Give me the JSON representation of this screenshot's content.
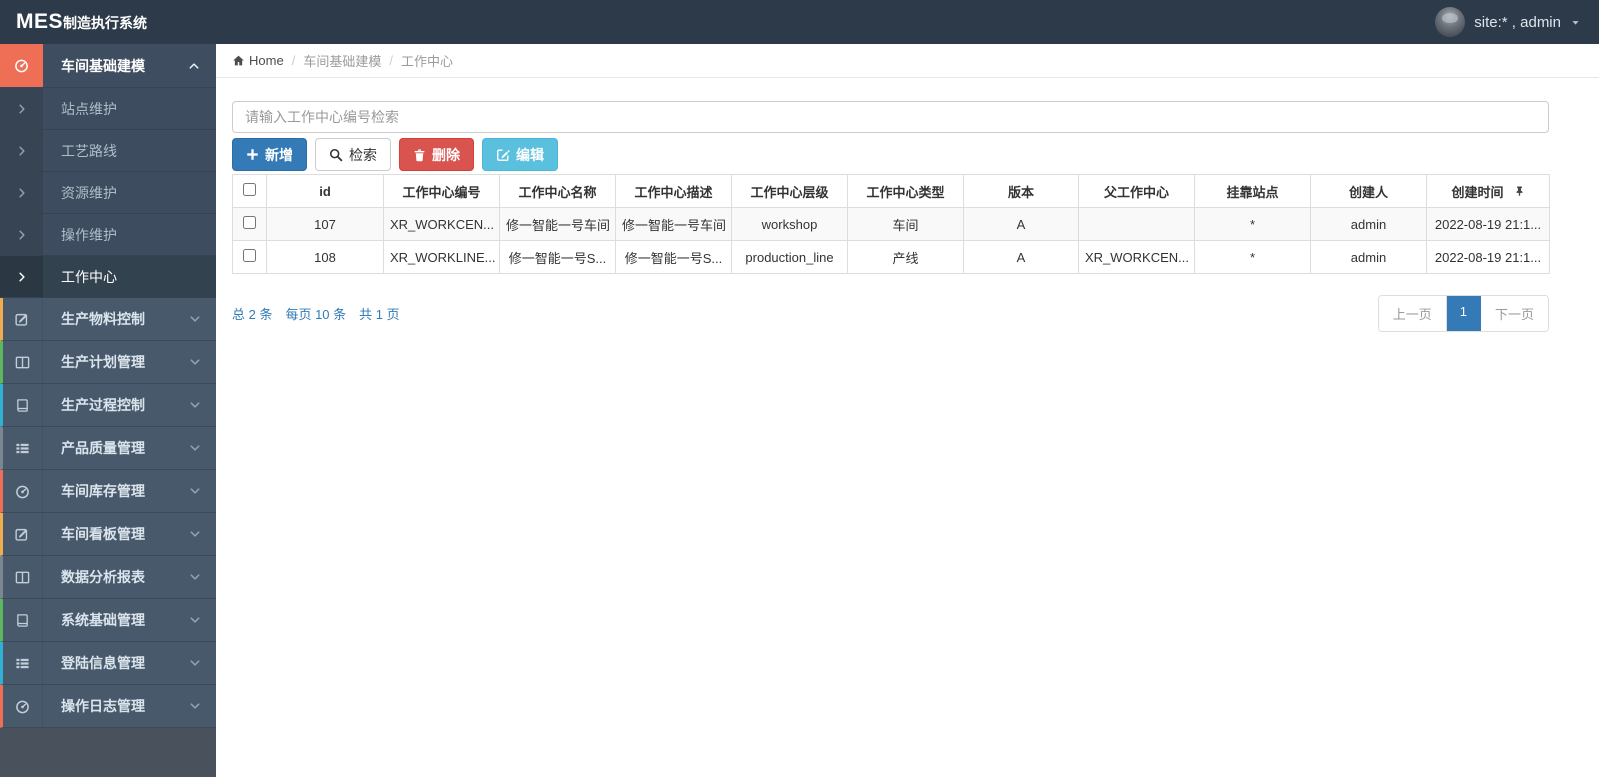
{
  "colors": {
    "topbar": "#2d3a4a",
    "sidebar_accent": "#ee6e56",
    "primary": "#337ab7",
    "danger": "#d9534f",
    "info": "#5bc0de"
  },
  "topbar": {
    "brand_bold": "MES",
    "brand_rest": "制造执行系统",
    "user_label": "site:* , admin"
  },
  "sidebar": {
    "group": {
      "label": "车间基础建模",
      "icon": "gauge"
    },
    "submenu": [
      {
        "label": "站点维护"
      },
      {
        "label": "工艺路线"
      },
      {
        "label": "资源维护"
      },
      {
        "label": "操作维护"
      },
      {
        "label": "工作中心"
      }
    ],
    "items": [
      {
        "label": "生产物料控制",
        "icon": "pencil",
        "stripe": "#f0ad4e"
      },
      {
        "label": "生产计划管理",
        "icon": "columns",
        "stripe": "#5cb85c"
      },
      {
        "label": "生产过程控制",
        "icon": "book",
        "stripe": "#31b0d5"
      },
      {
        "label": "产品质量管理",
        "icon": "list",
        "stripe": "#7a8793"
      },
      {
        "label": "车间库存管理",
        "icon": "gauge",
        "stripe": "#ee6e56"
      },
      {
        "label": "车间看板管理",
        "icon": "pencil",
        "stripe": "#f0ad4e"
      },
      {
        "label": "数据分析报表",
        "icon": "columns",
        "stripe": "#7a8793"
      },
      {
        "label": "系统基础管理",
        "icon": "book",
        "stripe": "#5cb85c"
      },
      {
        "label": "登陆信息管理",
        "icon": "list",
        "stripe": "#31b0d5"
      },
      {
        "label": "操作日志管理",
        "icon": "gauge",
        "stripe": "#ee6e56"
      }
    ]
  },
  "breadcrumb": {
    "home": "Home",
    "separator": "/",
    "items": [
      "车间基础建模",
      "工作中心"
    ]
  },
  "toolbar": {
    "search_placeholder": "请输入工作中心编号检索",
    "buttons": [
      {
        "label": "新增",
        "icon": "plus"
      },
      {
        "label": "检索",
        "icon": "search"
      },
      {
        "label": "删除",
        "icon": "trash"
      },
      {
        "label": "编辑",
        "icon": "edit"
      }
    ]
  },
  "table": {
    "columns": [
      "id",
      "工作中心编号",
      "工作中心名称",
      "工作中心描述",
      "工作中心层级",
      "工作中心类型",
      "版本",
      "父工作中心",
      "挂靠站点",
      "创建人",
      "创建时间"
    ],
    "rows": [
      [
        "107",
        "XR_WORKCEN...",
        "修一智能一号车间",
        "修一智能一号车间",
        "workshop",
        "车间",
        "A",
        "",
        "*",
        "admin",
        "2022-08-19 21:1..."
      ],
      [
        "108",
        "XR_WORKLINE...",
        "修一智能一号S...",
        "修一智能一号S...",
        "production_line",
        "产线",
        "A",
        "XR_WORKCEN...",
        "*",
        "admin",
        "2022-08-19 21:1..."
      ]
    ]
  },
  "pagination": {
    "summary": [
      "总 2 条",
      "每页 10 条",
      "共 1 页"
    ],
    "prev": "上一页",
    "current": "1",
    "next": "下一页"
  }
}
